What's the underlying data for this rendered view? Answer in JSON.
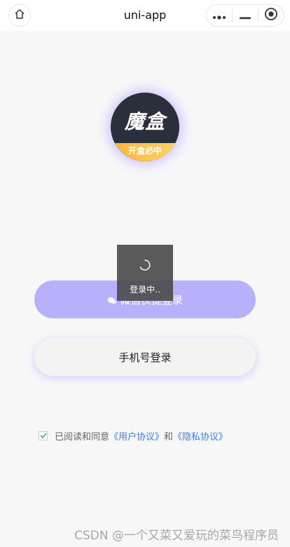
{
  "navbar": {
    "title": "uni-app",
    "home_icon": "home-icon",
    "capsule": {
      "more_icon": "more-dots-icon",
      "minimize_icon": "minimize-icon",
      "close_icon": "record-target-icon"
    }
  },
  "logo": {
    "main_text": "魔盒",
    "band_text": "开盒必中",
    "colors": {
      "background": "#2b2f3c",
      "band": "#f7b23b",
      "glow": "#9682ff"
    }
  },
  "buttons": {
    "wechat_label": "微信快捷登录",
    "wechat_icon": "wechat-icon",
    "phone_label": "手机号登录"
  },
  "toast": {
    "text": "登录中..",
    "icon": "spinner-icon"
  },
  "agreement": {
    "checked": true,
    "prefix": "已阅读和同意",
    "user_agreement": "《用户协议》",
    "and": "和",
    "privacy_policy": "《隐私协议》"
  },
  "watermark": "CSDN @一个又菜又爱玩的菜鸟程序员",
  "colors": {
    "accent": "#b7b0fb",
    "link": "#3c80e6",
    "background": "#f7f7f8"
  }
}
